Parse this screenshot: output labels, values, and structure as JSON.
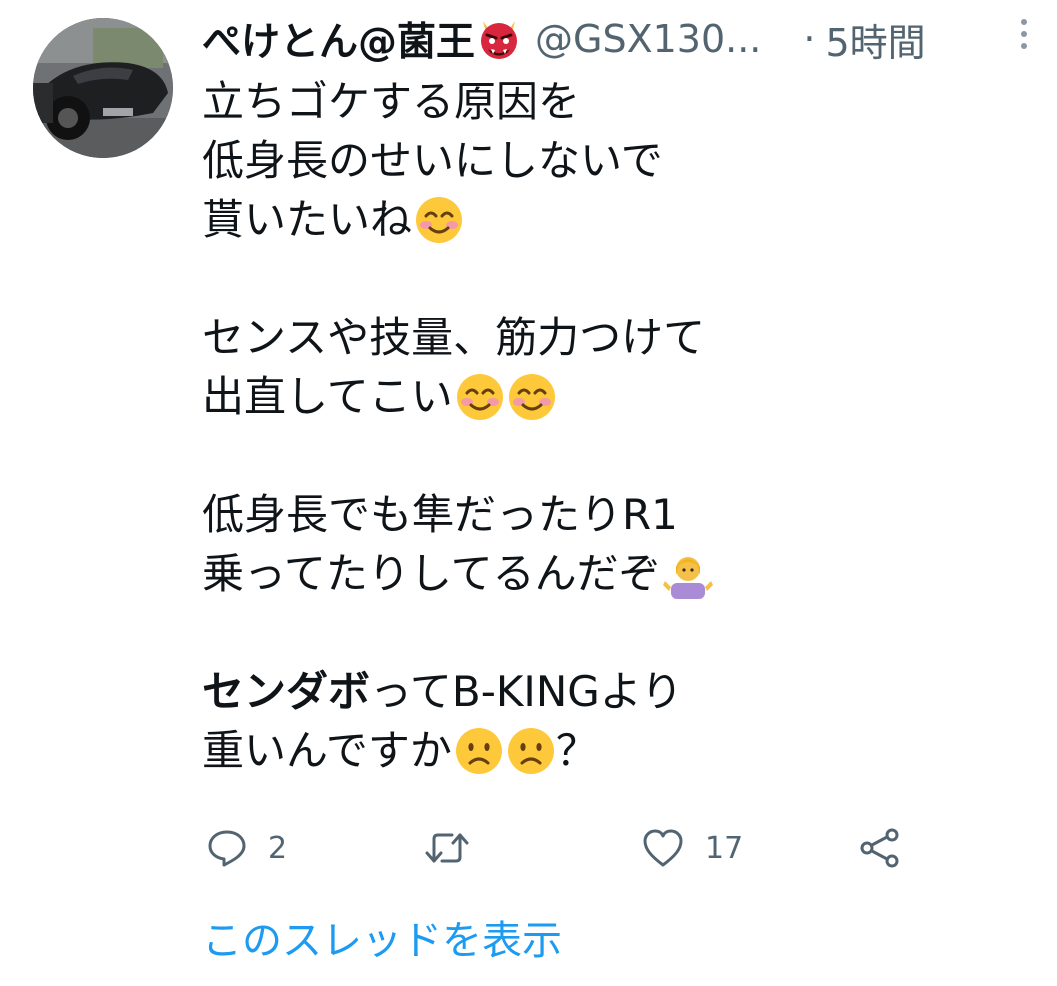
{
  "tweet": {
    "author": {
      "display_name": "ぺけとん@菌王",
      "name_emoji": "ogre-emoji",
      "handle": "@GSX130...",
      "separator": "·",
      "time": "5時間"
    },
    "lines": {
      "l1": "立ちゴケする原因を",
      "l2": "低身長のせいにしないで",
      "l3": "貰いたいね",
      "l4": "センスや技量、筋力つけて",
      "l5": "出直してこい",
      "l6": "低身長でも隼だったりR1",
      "l7": "乗ってたりしてるんだぞ",
      "l8_bold": "センダボ",
      "l8_rest": "ってB-KINGより",
      "l9": "重いんですか",
      "l9_tail": "？"
    },
    "actions": {
      "reply_count": "2",
      "retweet_count": "",
      "like_count": "17"
    },
    "show_thread": "このスレッドを表示"
  },
  "icons": {
    "reply": "speech-bubble-icon",
    "retweet": "retweet-arrows-icon",
    "like": "heart-outline-icon",
    "share": "share-nodes-icon",
    "more": "vertical-dots-icon"
  },
  "colors": {
    "text_primary": "#0f1419",
    "text_secondary": "#536471",
    "link": "#1d9bf0"
  }
}
